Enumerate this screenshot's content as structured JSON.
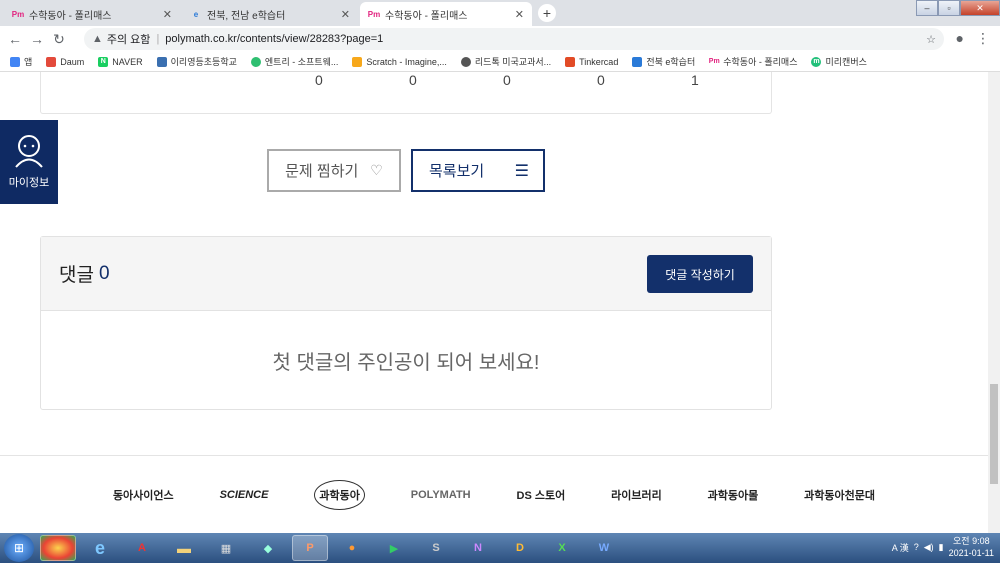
{
  "browser": {
    "tabs": [
      {
        "label": "수학동아 - 폴리매스",
        "icon": "Pm"
      },
      {
        "label": "전북, 전남 e학습터",
        "icon": "e"
      },
      {
        "label": "수학동아 - 폴리매스",
        "icon": "Pm"
      }
    ],
    "new_tab": "+",
    "url_warning": "주의 요함",
    "url": "polymath.co.kr/contents/view/28283?page=1",
    "bookmarks": [
      "앱",
      "Daum",
      "NAVER",
      "이리영등초등학교",
      "엔트리 - 소프트웨...",
      "Scratch - Imagine,...",
      "리드톡 미국교과서...",
      "Tinkercad",
      "전북 e학습터",
      "수학동아 - 폴리매스",
      "미리캔버스"
    ]
  },
  "stats_row": [
    "0",
    "0",
    "0",
    "0",
    "1"
  ],
  "sidebar": {
    "mypage_label": "마이정보"
  },
  "actions": {
    "favorite_label": "문제 찜하기",
    "list_label": "목록보기"
  },
  "comments": {
    "title": "댓글",
    "count": "0",
    "write_label": "댓글 작성하기",
    "empty_message": "첫 댓글의 주인공이 되어 보세요!"
  },
  "footer_logos": [
    "동아사이언스",
    "SCIENCE",
    "과학동아",
    "POLYMATH",
    "DS 스토어",
    "라이브러리",
    "과학동아몰",
    "과학동아천문대"
  ],
  "taskbar": {
    "time": "오전 9:08",
    "date": "2021-01-11"
  },
  "colors": {
    "primary": "#13306b",
    "page_bg": "#ffffff"
  }
}
